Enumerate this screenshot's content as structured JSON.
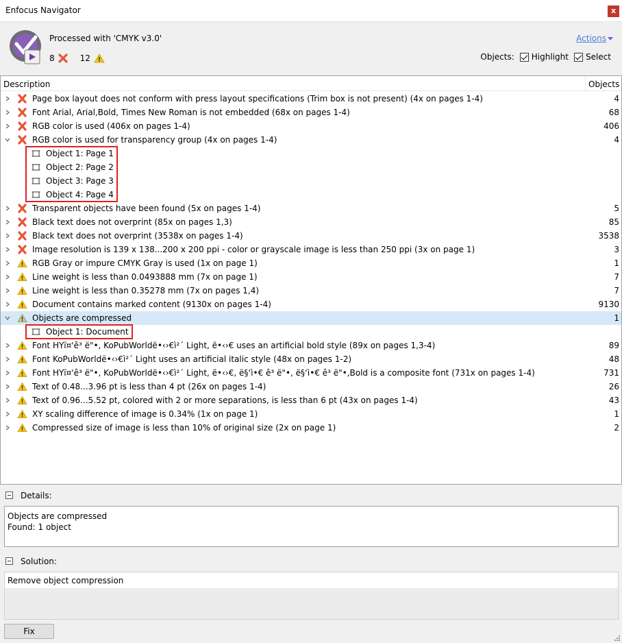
{
  "window": {
    "title": "Enfocus Navigator",
    "close_glyph": "x"
  },
  "header": {
    "processed_text": "Processed with 'CMYK v3.0'",
    "error_count": "8",
    "warning_count": "12",
    "actions_label": "Actions",
    "objects_label": "Objects:",
    "highlight_label": "Highlight",
    "select_label": "Select",
    "highlight_checked": true,
    "select_checked": true
  },
  "columns": {
    "description": "Description",
    "objects": "Objects"
  },
  "rows": [
    {
      "icon": "error",
      "expanded": false,
      "text": "Page box layout does not conform with press layout specifications (Trim box is not present) (4x on pages 1-4)",
      "count": "4"
    },
    {
      "icon": "error",
      "expanded": false,
      "text": "Font Arial, Arial,Bold, Times New Roman is not embedded (68x on pages 1-4)",
      "count": "68"
    },
    {
      "icon": "error",
      "expanded": false,
      "text": "RGB color is used (406x on pages 1-4)",
      "count": "406"
    },
    {
      "icon": "error",
      "expanded": true,
      "text": "RGB color is used for transparency group (4x on pages 1-4)",
      "count": "4",
      "children": [
        "Object 1: Page 1",
        "Object 2: Page 2",
        "Object 3: Page 3",
        "Object 4: Page 4"
      ]
    },
    {
      "icon": "error",
      "expanded": false,
      "text": "Transparent objects have been found (5x on pages 1-4)",
      "count": "5"
    },
    {
      "icon": "error",
      "expanded": false,
      "text": "Black text does not overprint (85x on pages 1,3)",
      "count": "85"
    },
    {
      "icon": "error",
      "expanded": false,
      "text": "Black text does not overprint (3538x on pages 1-4)",
      "count": "3538"
    },
    {
      "icon": "error",
      "expanded": false,
      "text": "Image resolution is 139 x 138...200 x 200 ppi - color or grayscale image is less than 250 ppi (3x on page 1)",
      "count": "3"
    },
    {
      "icon": "warning",
      "expanded": false,
      "text": "RGB Gray or impure CMYK Gray is used (1x on page 1)",
      "count": "1"
    },
    {
      "icon": "warning",
      "expanded": false,
      "text": "Line weight is less than 0.0493888 mm (7x on page 1)",
      "count": "7"
    },
    {
      "icon": "warning",
      "expanded": false,
      "text": "Line weight is less than 0.35278 mm (7x on pages 1,4)",
      "count": "7"
    },
    {
      "icon": "warning",
      "expanded": false,
      "text": "Document contains marked content (9130x on pages 1-4)",
      "count": "9130"
    },
    {
      "icon": "warning-gray",
      "expanded": true,
      "selected": true,
      "text": "Objects are compressed",
      "count": "1",
      "children": [
        "Object 1: Document"
      ]
    },
    {
      "icon": "warning",
      "expanded": false,
      "text": "Font HYï¤'ê³ ë\"•, KoPubWorldë•‹›€ì²´ Light, ë•‹›€ uses an artificial bold style (89x on pages 1,3-4)",
      "count": "89"
    },
    {
      "icon": "warning",
      "expanded": false,
      "text": "Font KoPubWorldë•‹›€ì²´ Light uses an artificial italic style (48x on pages 1-2)",
      "count": "48"
    },
    {
      "icon": "warning",
      "expanded": false,
      "text": "Font HYï¤'ê³ ë\"•, KoPubWorldë•‹›€ì²´ Light, ë•‹›€, ë§‘ì•€ ê³ ë\"•, ë§‘ì•€ ê³ ë\"•,Bold is a composite font (731x on pages 1-4)",
      "count": "731"
    },
    {
      "icon": "warning",
      "expanded": false,
      "text": "Text of 0.48...3.96 pt is less than 4 pt (26x on pages 1-4)",
      "count": "26"
    },
    {
      "icon": "warning",
      "expanded": false,
      "text": "Text of 0.96...5.52 pt, colored with 2 or more separations, is less than 6 pt (43x on pages 1-4)",
      "count": "43"
    },
    {
      "icon": "warning",
      "expanded": false,
      "text": "XY scaling difference of image is 0.34% (1x on page 1)",
      "count": "1"
    },
    {
      "icon": "warning",
      "expanded": false,
      "text": "Compressed size of image is less than 10% of original size (2x on page 1)",
      "count": "2"
    }
  ],
  "details": {
    "label": "Details:",
    "line1": "Objects are compressed",
    "line2": "Found: 1 object"
  },
  "solution": {
    "label": "Solution:",
    "text": "Remove object compression"
  },
  "fix_button": "Fix",
  "colors": {
    "error": "#e8543a",
    "warning": "#f5c518",
    "link": "#4d7cd5",
    "selection": "#d6e8f8",
    "highlight_box": "#e02020"
  }
}
